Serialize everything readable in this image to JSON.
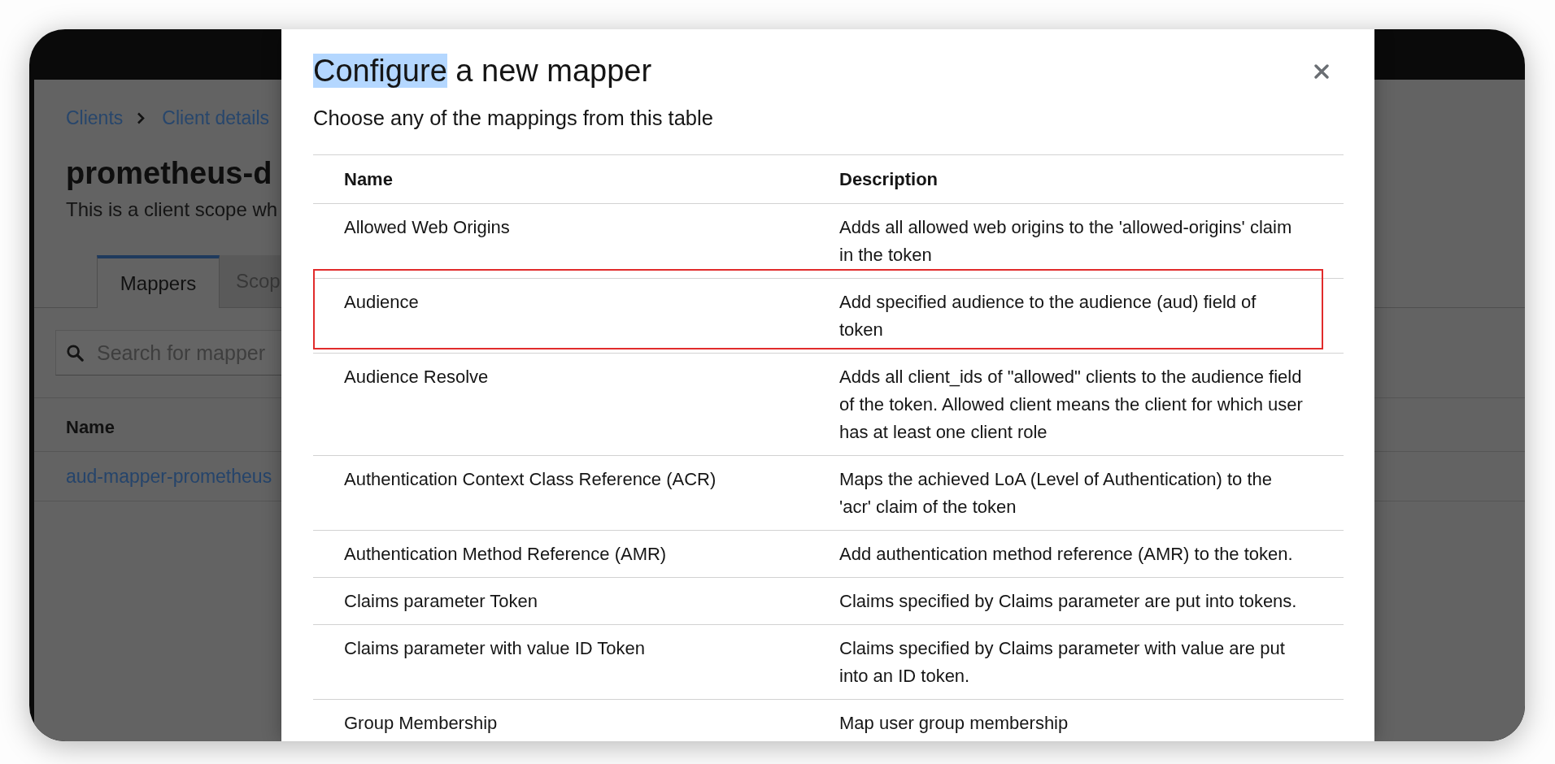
{
  "background_page": {
    "breadcrumb": [
      {
        "label": "Clients"
      },
      {
        "label": "Client details"
      }
    ],
    "title": "prometheus-d",
    "description": "This is a client scope wh",
    "tabs": [
      {
        "label": "Mappers",
        "selected": true
      },
      {
        "label": "Scop",
        "selected": false
      }
    ],
    "search": {
      "placeholder": "Search for mapper"
    },
    "table": {
      "columns": [
        "Name"
      ],
      "rows": [
        {
          "name": "aud-mapper-prometheus"
        }
      ]
    }
  },
  "modal": {
    "title": [
      {
        "text": "Configure",
        "highlighted": true
      },
      {
        "text": "a new mapper",
        "highlighted": false
      }
    ],
    "subtitle": "Choose any of the mappings from this table",
    "table": {
      "columns": [
        "Name",
        "Description"
      ],
      "rows": [
        {
          "name": "Allowed Web Origins",
          "description": "Adds all allowed web origins to the 'allowed-origins' claim in the token",
          "annotated": false
        },
        {
          "name": "Audience",
          "description": "Add specified audience to the audience (aud) field of token",
          "annotated": true
        },
        {
          "name": "Audience Resolve",
          "description": "Adds all client_ids of \"allowed\" clients to the audience field of the token. Allowed client means the client for which user has at least one client role",
          "annotated": false
        },
        {
          "name": "Authentication Context Class Reference (ACR)",
          "description": "Maps the achieved LoA (Level of Authentication) to the 'acr' claim of the token",
          "annotated": false
        },
        {
          "name": "Authentication Method Reference (AMR)",
          "description": "Add authentication method reference (AMR) to the token.",
          "annotated": false
        },
        {
          "name": "Claims parameter Token",
          "description": "Claims specified by Claims parameter are put into tokens.",
          "annotated": false
        },
        {
          "name": "Claims parameter with value ID Token",
          "description": "Claims specified by Claims parameter with value are put into an ID token.",
          "annotated": false
        },
        {
          "name": "Group Membership",
          "description": "Map user group membership",
          "annotated": false
        }
      ]
    }
  }
}
